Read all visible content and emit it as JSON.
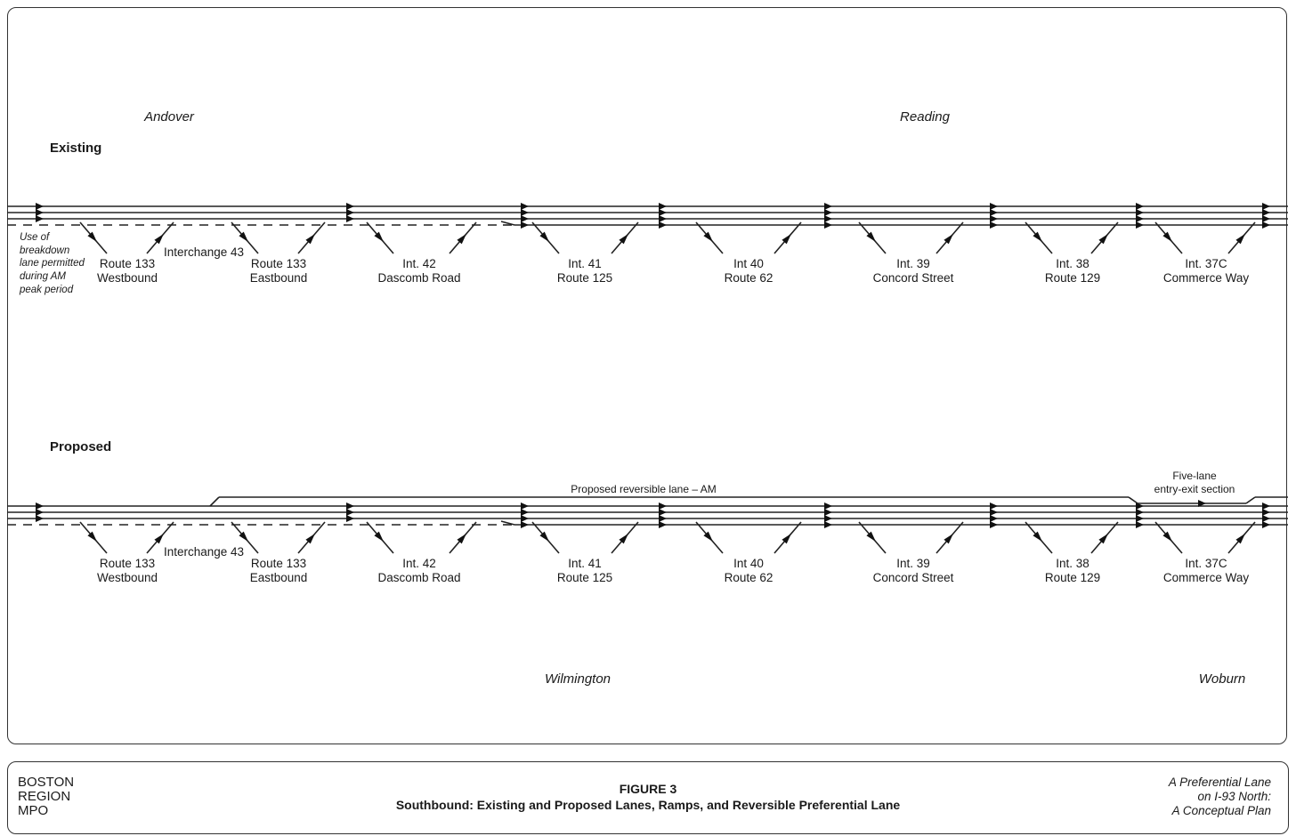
{
  "towns": {
    "andover": "Andover",
    "reading": "Reading",
    "wilmington": "Wilmington",
    "woburn": "Woburn"
  },
  "sections": {
    "existing": "Existing",
    "proposed": "Proposed"
  },
  "breakdown_note": "Use of\nbreakdown\nlane permitted\nduring AM\npeak period",
  "interchange_43": "Interchange 43",
  "reversible_lane_label": "Proposed reversible lane – AM",
  "five_lane_label": "Five-lane\nentry-exit section",
  "interchanges": [
    {
      "line1": "Route 133",
      "line2": "Westbound"
    },
    {
      "line1": "Route 133",
      "line2": "Eastbound"
    },
    {
      "line1": "Int. 42",
      "line2": "Dascomb Road"
    },
    {
      "line1": "Int. 41",
      "line2": "Route 125"
    },
    {
      "line1": "Int 40",
      "line2": "Route 62"
    },
    {
      "line1": "Int. 39",
      "line2": "Concord Street"
    },
    {
      "line1": "Int. 38",
      "line2": "Route 129"
    },
    {
      "line1": "Int. 37C",
      "line2": "Commerce Way"
    }
  ],
  "footer": {
    "org": "BOSTON\nREGION\nMPO",
    "figure": "FIGURE 3",
    "title": "Southbound: Existing and Proposed Lanes, Ramps, and Reversible Preferential Lane",
    "publication": "A Preferential Lane\non I-93 North:\nA Conceptual Plan"
  }
}
